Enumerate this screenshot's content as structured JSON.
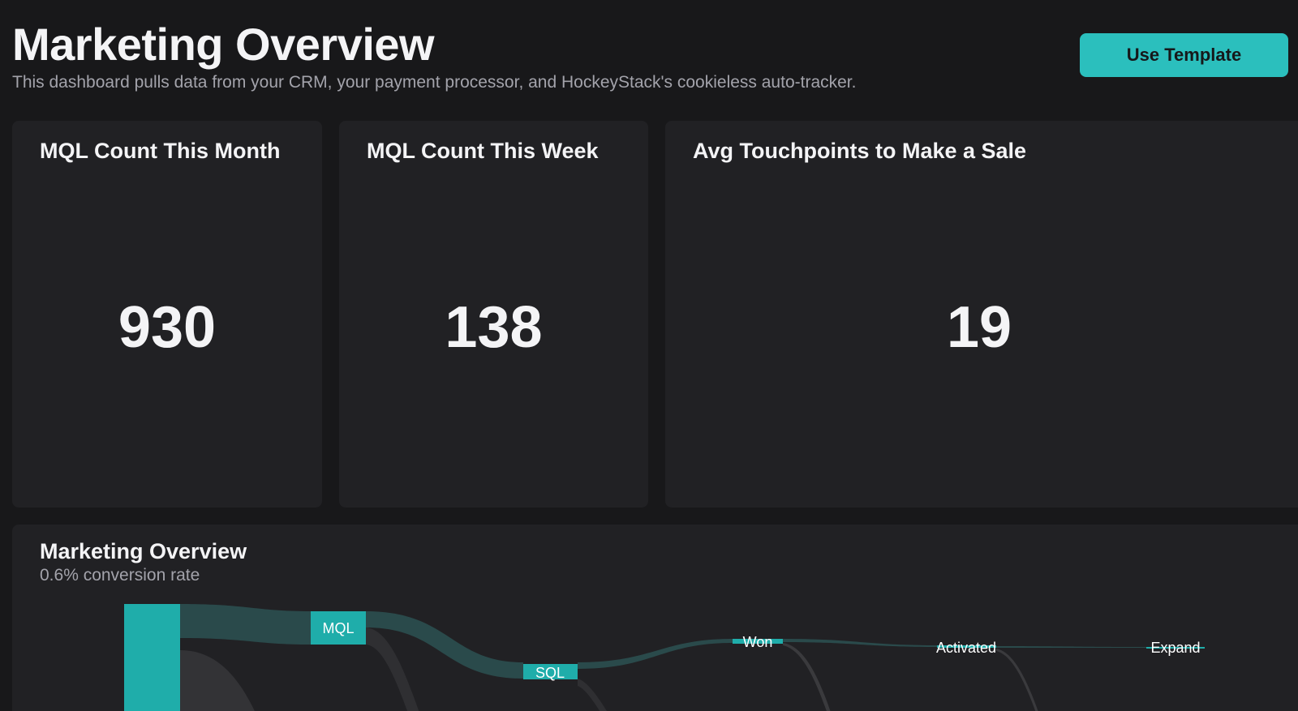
{
  "header": {
    "title": "Marketing Overview",
    "subtitle": "This dashboard pulls data from your CRM, your payment processor, and HockeyStack's cookieless auto-tracker.",
    "use_template_label": "Use Template"
  },
  "metrics": [
    {
      "title": "MQL Count This Month",
      "value": "930"
    },
    {
      "title": "MQL Count This Week",
      "value": "138"
    },
    {
      "title": "Avg Touchpoints to Make a Sale",
      "value": "19"
    }
  ],
  "overview": {
    "title": "Marketing Overview",
    "subtitle": "0.6% conversion rate",
    "stages": [
      "MQL",
      "SQL",
      "Won",
      "Activated",
      "Expand"
    ]
  },
  "colors": {
    "accent": "#2bbfbd",
    "background": "#18181a",
    "card": "#212124",
    "flow": "#2a4a4b"
  }
}
